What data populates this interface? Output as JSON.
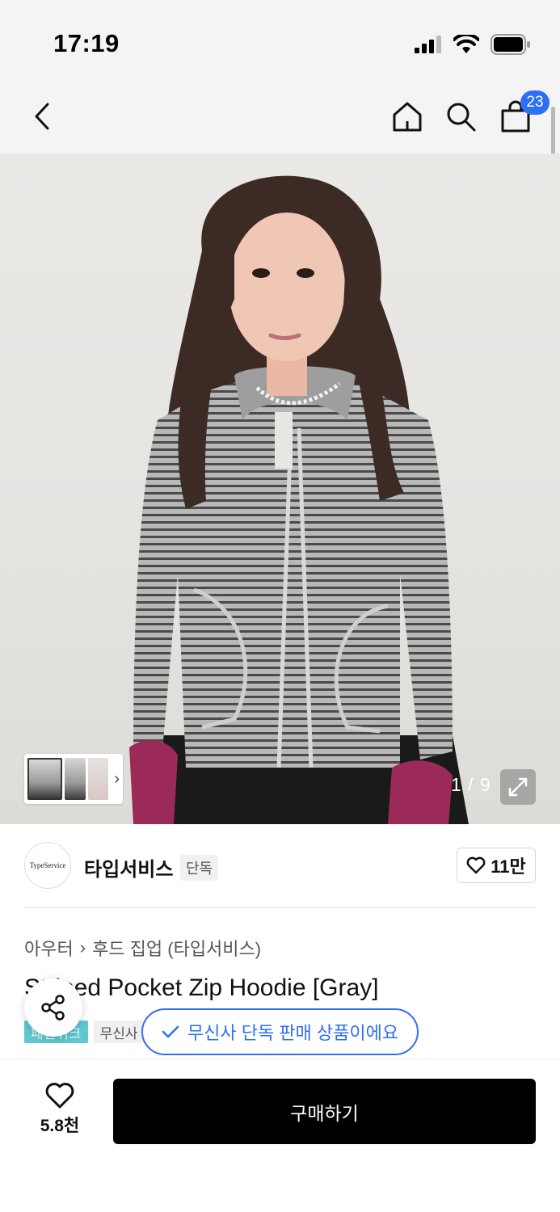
{
  "status_bar": {
    "time": "17:19"
  },
  "nav": {
    "cart_count": "23"
  },
  "gallery": {
    "counter": "1 / 9"
  },
  "brand": {
    "logo_text": "TypeService",
    "name": "타입서비스",
    "tag": "단독",
    "likes": "11만"
  },
  "product": {
    "breadcrumb": [
      "아우터",
      "후드 집업 (타입서비스)"
    ],
    "title": "Striped Pocket Zip Hoodie [Gray]",
    "tags": [
      "패션위크",
      "무신사"
    ]
  },
  "toast": {
    "message": "무신사 단독 판매 상품이에요"
  },
  "bottom": {
    "like_count": "5.8천",
    "buy_label": "구매하기"
  },
  "colors": {
    "accent": "#2d6ff5",
    "teal_tag": "#5fc7cf",
    "buy_button": "#000000"
  }
}
